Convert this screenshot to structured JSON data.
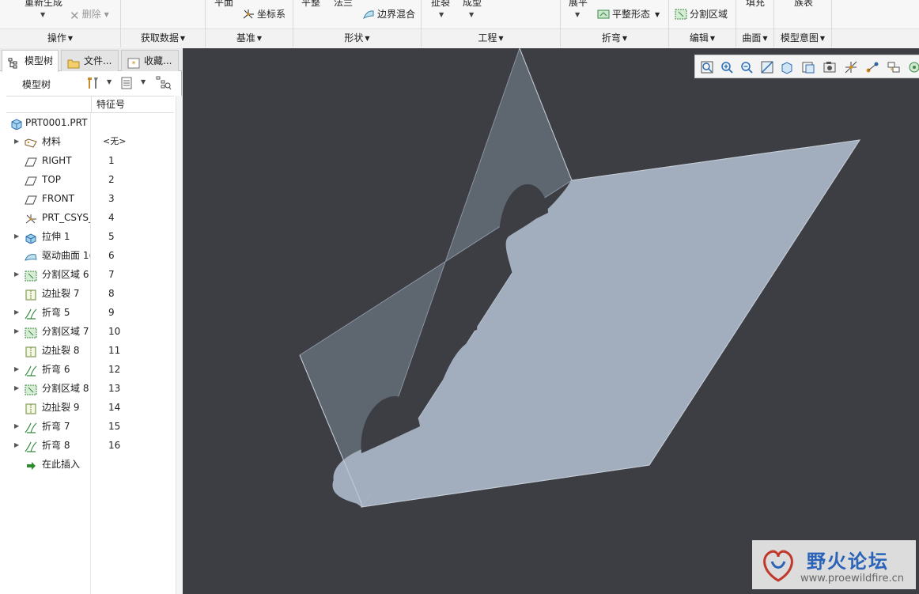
{
  "ribbon": {
    "groups": {
      "operations": "操作",
      "get_data": "获取数据",
      "datum": "基准",
      "shape": "形状",
      "engineering": "工程",
      "bend": "折弯",
      "edit": "编辑",
      "surface": "曲面",
      "model_intent": "模型意图"
    },
    "buttons": {
      "regenerate": "重新生成",
      "delete": "删除",
      "plane": "平面",
      "csys": "坐标系",
      "flat": "平整",
      "normal": "法兰",
      "boundary_blend": "边界混合",
      "rip": "扯裂",
      "form": "成型",
      "unbend": "展平",
      "flat_form": "平整形态",
      "split_area": "分割区域",
      "fill": "填充",
      "family_table": "族表"
    }
  },
  "panel": {
    "tabs": [
      "模型树",
      "文件...",
      "收藏..."
    ],
    "tree_label": "模型树",
    "column_header": "特征号",
    "root": "PRT0001.PRT",
    "items": [
      {
        "name": "材料",
        "num": "<无>",
        "icon": "material-icon",
        "expand": true
      },
      {
        "name": "RIGHT",
        "num": "1",
        "icon": "datum-plane-icon",
        "expand": false
      },
      {
        "name": "TOP",
        "num": "2",
        "icon": "datum-plane-icon",
        "expand": false
      },
      {
        "name": "FRONT",
        "num": "3",
        "icon": "datum-plane-icon",
        "expand": false
      },
      {
        "name": "PRT_CSYS_",
        "num": "4",
        "icon": "csys-icon",
        "expand": false
      },
      {
        "name": "拉伸 1",
        "num": "5",
        "icon": "extrude-icon",
        "expand": true
      },
      {
        "name": "驱动曲面 1(",
        "num": "6",
        "icon": "driving-surface-icon",
        "expand": false
      },
      {
        "name": "分割区域 6",
        "num": "7",
        "icon": "split-area-icon",
        "expand": true
      },
      {
        "name": "边扯裂 7",
        "num": "8",
        "icon": "edge-rip-icon",
        "expand": false
      },
      {
        "name": "折弯 5",
        "num": "9",
        "icon": "bend-icon",
        "expand": true
      },
      {
        "name": "分割区域 7",
        "num": "10",
        "icon": "split-area-icon",
        "expand": true
      },
      {
        "name": "边扯裂 8",
        "num": "11",
        "icon": "edge-rip-icon",
        "expand": false
      },
      {
        "name": "折弯 6",
        "num": "12",
        "icon": "bend-icon",
        "expand": true
      },
      {
        "name": "分割区域 8",
        "num": "13",
        "icon": "split-area-icon",
        "expand": true
      },
      {
        "name": "边扯裂 9",
        "num": "14",
        "icon": "edge-rip-icon",
        "expand": false
      },
      {
        "name": "折弯 7",
        "num": "15",
        "icon": "bend-icon",
        "expand": true
      },
      {
        "name": "折弯 8",
        "num": "16",
        "icon": "bend-icon",
        "expand": true
      },
      {
        "name": "在此插入",
        "num": "",
        "icon": "insert-here-icon",
        "expand": false
      }
    ]
  },
  "watermark": {
    "title": "野火论坛",
    "url": "www.proewildfire.cn"
  },
  "colors": {
    "viewport_bg": "#3d3d44",
    "model_front_face": "#a2aebd",
    "model_back_face": "#5e6670",
    "brand_blue": "#2a63b8"
  }
}
